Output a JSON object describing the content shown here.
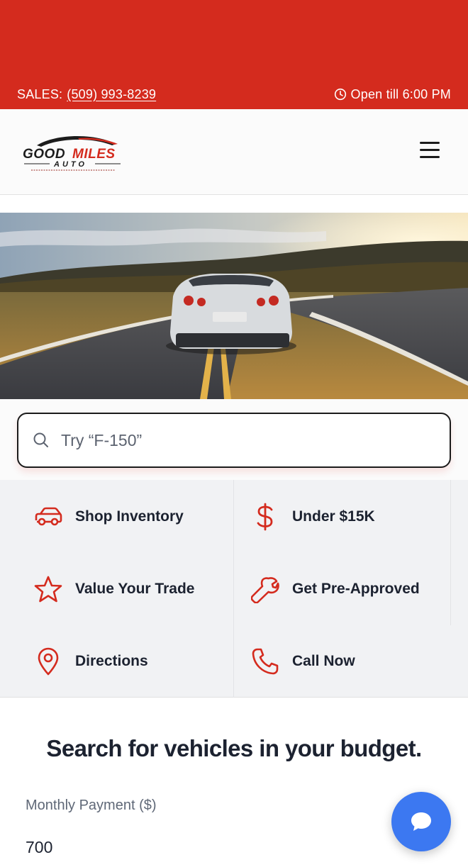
{
  "topbar": {
    "sales_label": "SALES:",
    "phone": "(509) 993-8239",
    "hours": "Open till 6:00 PM",
    "color": "#d42b1e"
  },
  "header": {
    "logo_text_top": "GOOD MILES",
    "logo_text_bottom": "A U T O",
    "menu_icon": "hamburger-icon"
  },
  "search": {
    "placeholder": "Try “F-150”",
    "value": ""
  },
  "quick_links": [
    {
      "label": "Shop Inventory",
      "icon": "car-icon"
    },
    {
      "label": "Under $15K",
      "icon": "dollar-icon"
    },
    {
      "label": "Value Your Trade",
      "icon": "star-icon"
    },
    {
      "label": "Get Pre-Approved",
      "icon": "wrench-icon"
    },
    {
      "label": "Directions",
      "icon": "map-pin-icon"
    },
    {
      "label": "Call Now",
      "icon": "phone-icon"
    }
  ],
  "budget": {
    "title": "Search for vehicles in your budget.",
    "monthly_label": "Monthly Payment ($)",
    "monthly_value": "700"
  },
  "chat": {
    "icon": "chat-bubble-icon",
    "color": "#3c78f1"
  },
  "accent_color": "#d42b1e"
}
